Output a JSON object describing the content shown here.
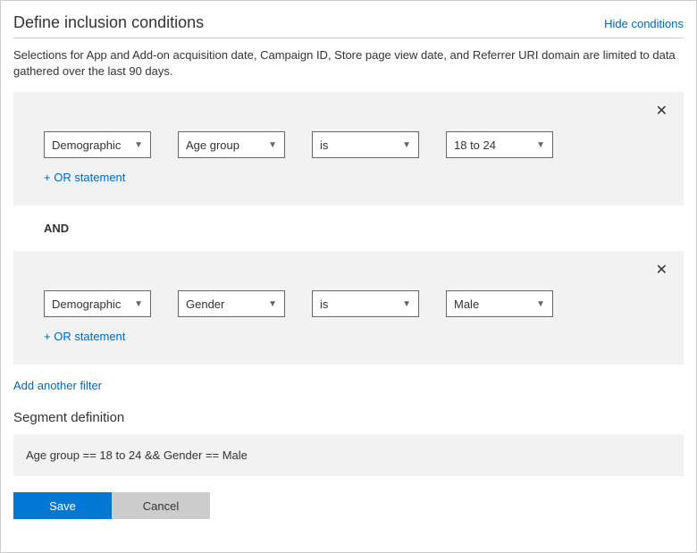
{
  "header": {
    "title": "Define inclusion conditions",
    "hide_link": "Hide conditions"
  },
  "description": "Selections for App and Add-on acquisition date, Campaign ID, Store page view date, and Referrer URI domain are limited to data gathered over the last 90 days.",
  "filters": [
    {
      "category": "Demographic",
      "attribute": "Age group",
      "operator": "is",
      "value": "18 to 24",
      "or_label": "+ OR statement"
    },
    {
      "category": "Demographic",
      "attribute": "Gender",
      "operator": "is",
      "value": "Male",
      "or_label": "+ OR statement"
    }
  ],
  "and_label": "AND",
  "add_filter_label": "Add another filter",
  "segment_definition": {
    "title": "Segment definition",
    "expression": "Age group == 18 to 24 && Gender == Male"
  },
  "buttons": {
    "save": "Save",
    "cancel": "Cancel"
  }
}
